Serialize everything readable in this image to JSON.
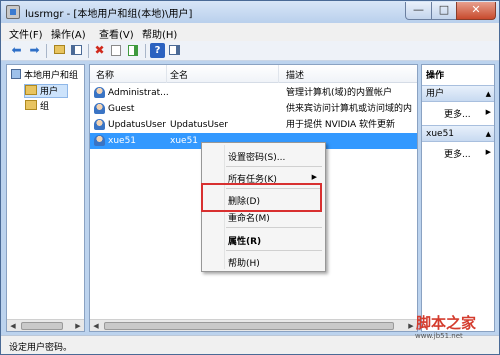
{
  "window": {
    "title": "lusrmgr - [本地用户和组(本地)\\用户]",
    "minimize_glyph": "—",
    "maximize_glyph": "□",
    "close_glyph": "✕"
  },
  "menubar": [
    "文件(F)",
    "操作(A)",
    "查看(V)",
    "帮助(H)"
  ],
  "toolbar": {
    "icons": [
      "back-arrow-icon",
      "forward-arrow-icon",
      "up-folder-icon",
      "console-tree-icon",
      "delete-icon",
      "properties-icon",
      "export-icon",
      "help-icon",
      "show-hide-pane-icon"
    ],
    "glyphs": {
      "back": "⬅",
      "forward": "➡",
      "delete": "✖",
      "help": "?"
    }
  },
  "tree": {
    "root": "本地用户和组",
    "children": [
      "用户",
      "组"
    ],
    "selected": "用户"
  },
  "list": {
    "columns": [
      "名称",
      "全名",
      "描述"
    ],
    "rows": [
      {
        "name": "Administrat...",
        "fullname": "",
        "desc": "管理计算机(域)的内置帐户"
      },
      {
        "name": "Guest",
        "fullname": "",
        "desc": "供来宾访问计算机或访问域的内"
      },
      {
        "name": "UpdatusUser",
        "fullname": "UpdatusUser",
        "desc": "用于提供 NVIDIA 软件更新"
      },
      {
        "name": "xue51",
        "fullname": "xue51",
        "desc": ""
      }
    ],
    "selected_row": "xue51"
  },
  "actions": {
    "title": "操作",
    "sections": [
      {
        "header": "用户",
        "link": "更多..."
      },
      {
        "header": "xue51",
        "link": "更多..."
      }
    ]
  },
  "context_menu": {
    "items": [
      "设置密码(S)...",
      "所有任务(K)",
      "删除(D)",
      "重命名(M)",
      "属性(R)",
      "帮助(H)"
    ],
    "highlighted": "删除(D)",
    "submenu_arrow": "▶"
  },
  "status": {
    "text": "设定用户密码。"
  },
  "watermark": {
    "text": "脚本之家",
    "url": "www.jb51.net"
  },
  "colors": {
    "selection": "#3399ff",
    "highlight_box": "#d83030",
    "watermark": "#d43c2e"
  }
}
